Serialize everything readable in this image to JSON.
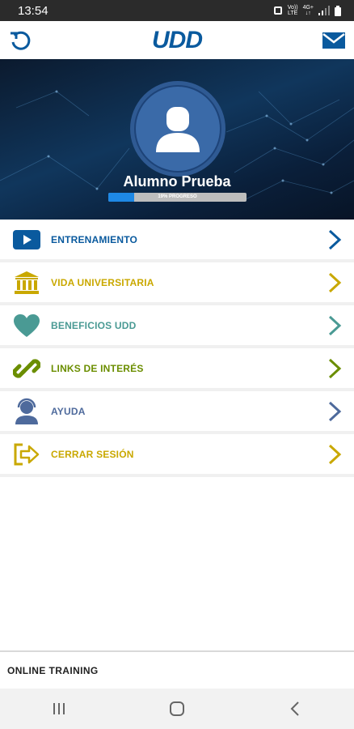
{
  "status_bar": {
    "time": "13:54",
    "network_labels": [
      "Vo))",
      "LTE",
      "4G+",
      "↓↑"
    ]
  },
  "header": {
    "logo_text": "UDD",
    "brand_color": "#0a5a9e"
  },
  "profile": {
    "name": "Alumno Prueba",
    "progress_label": "19% PROGRESO",
    "progress_percent": 19
  },
  "menu": {
    "items": [
      {
        "label": "ENTRENAMIENTO",
        "icon": "video-play-icon",
        "color": "#0a5a9e"
      },
      {
        "label": "VIDA UNIVERSITARIA",
        "icon": "university-icon",
        "color": "#c9a800"
      },
      {
        "label": "BENEFICIOS UDD",
        "icon": "heart-icon",
        "color": "#4a9a94"
      },
      {
        "label": "LINKS DE INTERÉS",
        "icon": "link-icon",
        "color": "#6b8e00"
      },
      {
        "label": "AYUDA",
        "icon": "support-agent-icon",
        "color": "#4e6a9c"
      },
      {
        "label": "CERRAR SESIÓN",
        "icon": "logout-icon",
        "color": "#c9a800"
      }
    ]
  },
  "footer": {
    "text": "ONLINE TRAINING"
  }
}
